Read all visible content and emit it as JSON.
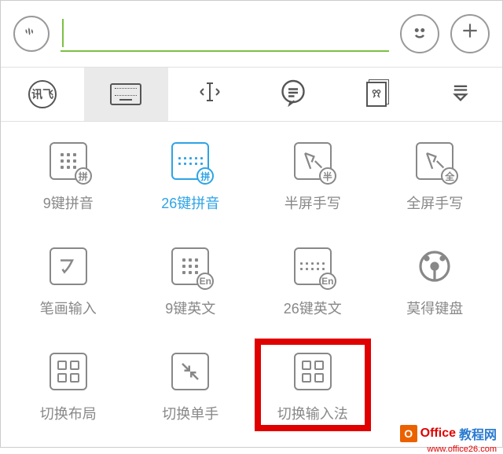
{
  "topbar": {
    "input_value": ""
  },
  "toolrow": {
    "logo_text": "讯飞"
  },
  "grid": {
    "items": [
      {
        "label": "9键拼音",
        "badge": "拼"
      },
      {
        "label": "26键拼音",
        "badge": "拼"
      },
      {
        "label": "半屏手写",
        "badge": "半"
      },
      {
        "label": "全屏手写",
        "badge": "全"
      },
      {
        "label": "笔画输入",
        "badge": ""
      },
      {
        "label": "9键英文",
        "badge": "En"
      },
      {
        "label": "26键英文",
        "badge": "En"
      },
      {
        "label": "莫得键盘",
        "badge": ""
      },
      {
        "label": "切换布局",
        "badge": ""
      },
      {
        "label": "切换单手",
        "badge": ""
      },
      {
        "label": "切换输入法",
        "badge": ""
      }
    ]
  },
  "watermark": {
    "brand1": "Office",
    "brand2": "教程网",
    "url": "www.office26.com"
  }
}
